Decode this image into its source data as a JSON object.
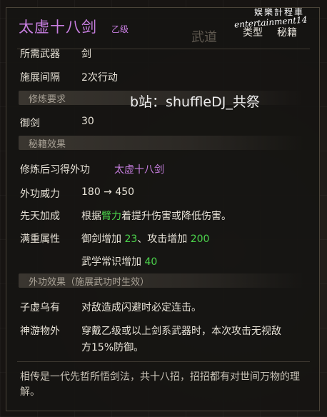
{
  "skill": {
    "name": "太虚十八剑",
    "grade": "乙级",
    "tab_faded": "武道",
    "type_label": "类型",
    "type_value": "秘籍"
  },
  "watermarks": {
    "brand": "娱樂計程車",
    "signature": "entertainment14",
    "bilibili": "b站：shuffleDJ_共祭"
  },
  "basic": [
    {
      "label": "所需武器",
      "value": "剑"
    },
    {
      "label": "施展间隔",
      "value": "2次行动"
    }
  ],
  "requirements": {
    "title": "修炼要求",
    "items": [
      {
        "label": "御剑",
        "value": "30"
      }
    ]
  },
  "effects": {
    "title": "秘籍效果",
    "learn_label": "修炼后习得外功",
    "learn_value": "太虚十八剑",
    "power_label": "外功威力",
    "power_value": "180 → 450",
    "innate_label": "先天加成",
    "innate_pre": "根据",
    "innate_highlight": "臂力",
    "innate_post": "着提升伤害或降低伤害。",
    "mastery_label": "满重属性",
    "mastery_1_pre": "御剑增加 ",
    "mastery_1_val": "23",
    "mastery_1_mid": "、攻击增加 ",
    "mastery_1_val2": "200",
    "mastery_2_pre": "武学常识增加 ",
    "mastery_2_val": "40"
  },
  "external": {
    "title": "外功效果（施展武功时生效）",
    "items": [
      {
        "label": "子虚乌有",
        "value": "对敌造成闪避时必定连击。"
      },
      {
        "label": "神游物外",
        "value": "穿戴乙级或以上剑系武器时，本次攻击无视敌",
        "value2": "方15%防御。"
      }
    ]
  },
  "lore": "相传是一代先哲所悟剑法，共十八招，招招都有对世间万物的理解。",
  "colors": {
    "purple": "#c77ee0",
    "green": "#4bd44b"
  }
}
